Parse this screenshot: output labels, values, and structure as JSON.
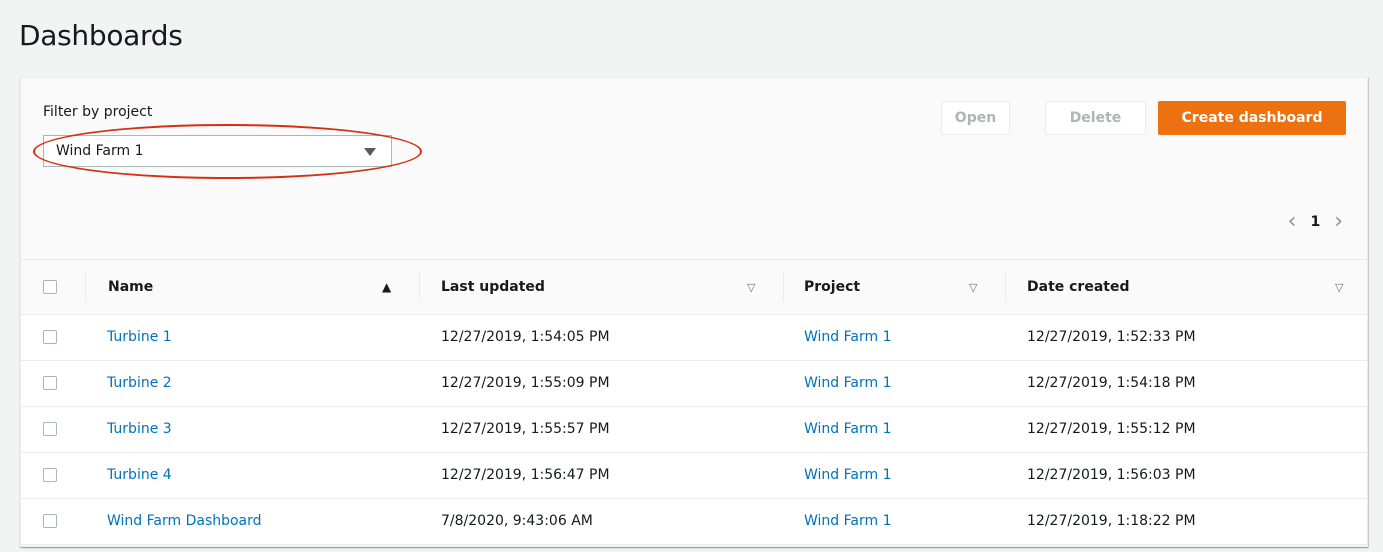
{
  "page": {
    "title": "Dashboards"
  },
  "filter": {
    "label": "Filter by project",
    "selected": "Wind Farm 1"
  },
  "actions": {
    "open": "Open",
    "delete": "Delete",
    "create": "Create dashboard"
  },
  "pagination": {
    "current": "1",
    "prev": "‹",
    "next": "›"
  },
  "table": {
    "columns": [
      "Name",
      "Last updated",
      "Project",
      "Date created"
    ],
    "rows": [
      {
        "name": "Turbine 1",
        "last_updated": "12/27/2019, 1:54:05 PM",
        "project": "Wind Farm 1",
        "date_created": "12/27/2019, 1:52:33 PM"
      },
      {
        "name": "Turbine 2",
        "last_updated": "12/27/2019, 1:55:09 PM",
        "project": "Wind Farm 1",
        "date_created": "12/27/2019, 1:54:18 PM"
      },
      {
        "name": "Turbine 3",
        "last_updated": "12/27/2019, 1:55:57 PM",
        "project": "Wind Farm 1",
        "date_created": "12/27/2019, 1:55:12 PM"
      },
      {
        "name": "Turbine 4",
        "last_updated": "12/27/2019, 1:56:47 PM",
        "project": "Wind Farm 1",
        "date_created": "12/27/2019, 1:56:03 PM"
      },
      {
        "name": "Wind Farm Dashboard",
        "last_updated": "7/8/2020, 9:43:06 AM",
        "project": "Wind Farm 1",
        "date_created": "12/27/2019, 1:18:22 PM"
      }
    ]
  },
  "colors": {
    "primary": "#ec7211",
    "link": "#0073bb",
    "highlight": "#d13212"
  }
}
